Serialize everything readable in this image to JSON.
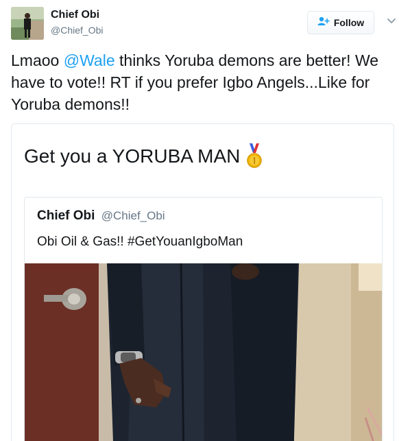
{
  "user": {
    "name": "Chief Obi",
    "handle": "@Chief_Obi"
  },
  "follow_label": "Follow",
  "tweet": {
    "text_before": "Lmaoo ",
    "mention": "@Wale",
    "text_after": " thinks Yoruba demons are better! We have to vote!! RT if you prefer Igbo Angels...Like for Yoruba demons!!"
  },
  "quote": {
    "text": "Get you a YORUBA MAN",
    "inner": {
      "name": "Chief Obi",
      "handle": "@Chief_Obi",
      "text": "Obi Oil & Gas!! #GetYouanIgboMan"
    }
  },
  "icons": {
    "follow": "add-user-icon",
    "menu": "chevron-down-icon",
    "medal": "gold-medal-icon"
  },
  "colors": {
    "mention": "#1da1f2",
    "handle": "#657786",
    "border": "#e1e8ed"
  }
}
